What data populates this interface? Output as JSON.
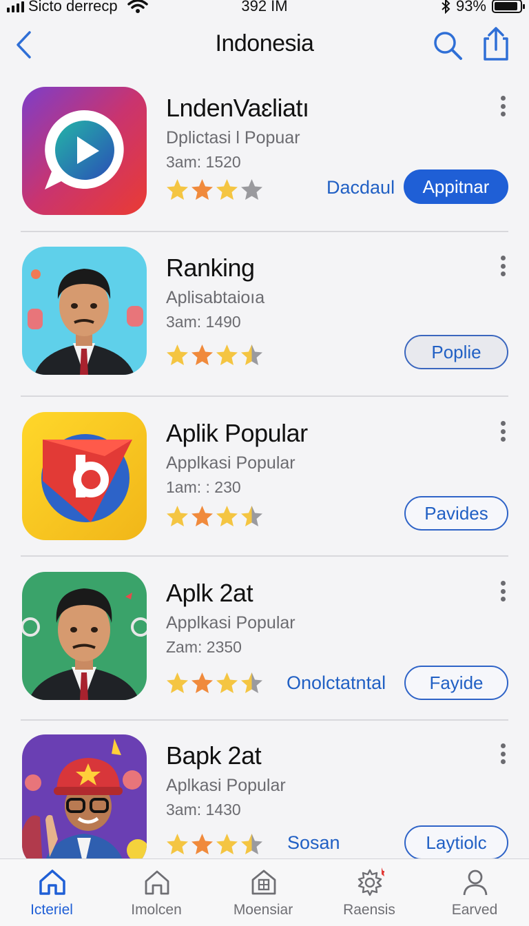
{
  "status_bar": {
    "carrier": "Sicto derrecp",
    "time": "392 IM",
    "battery": "93%",
    "battery_level": 0.93
  },
  "header": {
    "title": "Indonesia",
    "back_icon": "chevron-left-icon",
    "search_icon": "search-icon",
    "share_icon": "share-icon"
  },
  "apps": [
    {
      "name": "LndenVaɛliatı",
      "category": "Dplictasi l Popuar",
      "meta": "3am: 1520",
      "rating": 3,
      "link": "Dacdaul",
      "button": "Appitnar"
    },
    {
      "name": "Ranking",
      "category": "Aplisabtaioıa",
      "meta": "3am: 1490",
      "rating": 3.5,
      "button": "Poplie"
    },
    {
      "name": "Aplik Popular",
      "category": "Applkasi Popular",
      "meta": "1am: : 230",
      "rating": 3.5,
      "button": "Pavides"
    },
    {
      "name": "Aplk 2at",
      "category": "Applkasi Popular",
      "meta": "Zam: 2350",
      "rating": 3.5,
      "link": "Onolctatntal",
      "button": "Fayide"
    },
    {
      "name": "Bapk 2at",
      "category": "Aplkasi Popular",
      "meta": "3am: 1430",
      "rating": 3.5,
      "link": "Sosan",
      "button": "Laytiolc"
    }
  ],
  "tabs": [
    {
      "label": "Icteriel",
      "icon": "home-icon",
      "active": true
    },
    {
      "label": "Imolcen",
      "icon": "home-outline-icon",
      "active": false
    },
    {
      "label": "Moensiar",
      "icon": "building-icon",
      "active": false
    },
    {
      "label": "Raensis",
      "icon": "gear-icon",
      "active": false
    },
    {
      "label": "Earved",
      "icon": "person-icon",
      "active": false
    }
  ],
  "colors": {
    "accent": "#1f5fd6",
    "star_gold": "#f4c542",
    "star_orange": "#f08a3c",
    "star_grey": "#9a9a9e"
  }
}
